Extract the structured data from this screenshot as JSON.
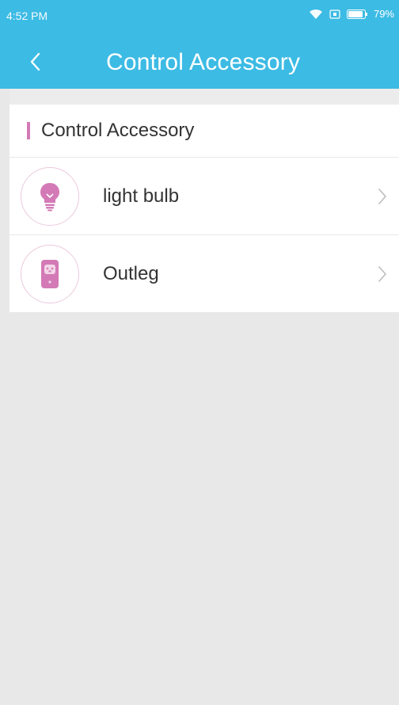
{
  "status_bar": {
    "time": "4:52 PM",
    "battery": "79%",
    "icons": [
      "wifi-icon",
      "sim-icon",
      "battery-icon"
    ]
  },
  "app_bar": {
    "back_icon": "chevron-left-icon",
    "title": "Control Accessory"
  },
  "section": {
    "title": "Control Accessory"
  },
  "accessories": [
    {
      "label": "light bulb",
      "icon": "light-bulb-icon"
    },
    {
      "label": "Outleg",
      "icon": "outlet-icon"
    }
  ],
  "colors": {
    "header": "#3cbbe4",
    "accent": "#d37ab6",
    "background": "#e8e8e8",
    "icon_ring": "#ecc9dd"
  }
}
